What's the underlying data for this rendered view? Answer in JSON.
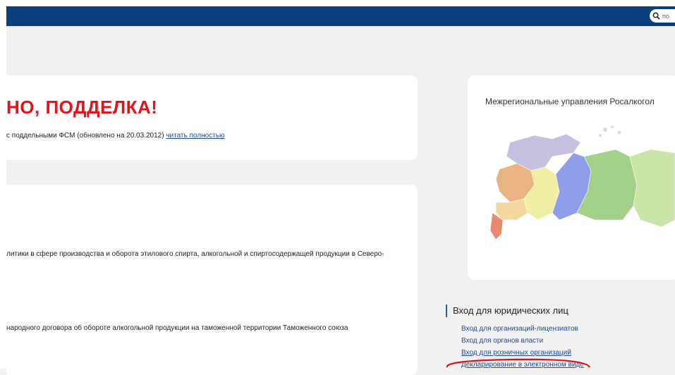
{
  "header": {
    "search_placeholder": "по"
  },
  "alert_card": {
    "headline": "НО, ПОДДЕЛКА!",
    "text": "с поддельными ФСМ (обновлено на 20.03.2012)",
    "read_more": "читать полностью"
  },
  "news_card": {
    "item1": "литики в сфере производства и оборота этилового спирта, алкогольной и спиртосодержащей продукции в Северо-",
    "item2": "народного договора об обороте алкогольной продукции на таможенной территории Таможенного союза"
  },
  "map_card": {
    "title": "Межрегиональные управления Росалкогол"
  },
  "legal_entities": {
    "heading": "Вход для юридических лиц",
    "links": [
      "Вход для организаций-лицензиатов",
      "Вход для органов власти",
      "Вход для розничных организаций",
      "Декларирование в электронном виде"
    ]
  },
  "colors": {
    "topbar": "#0b3e7d",
    "headline": "#e8101a",
    "link": "#1f4a99",
    "annotation": "#e0101a"
  }
}
